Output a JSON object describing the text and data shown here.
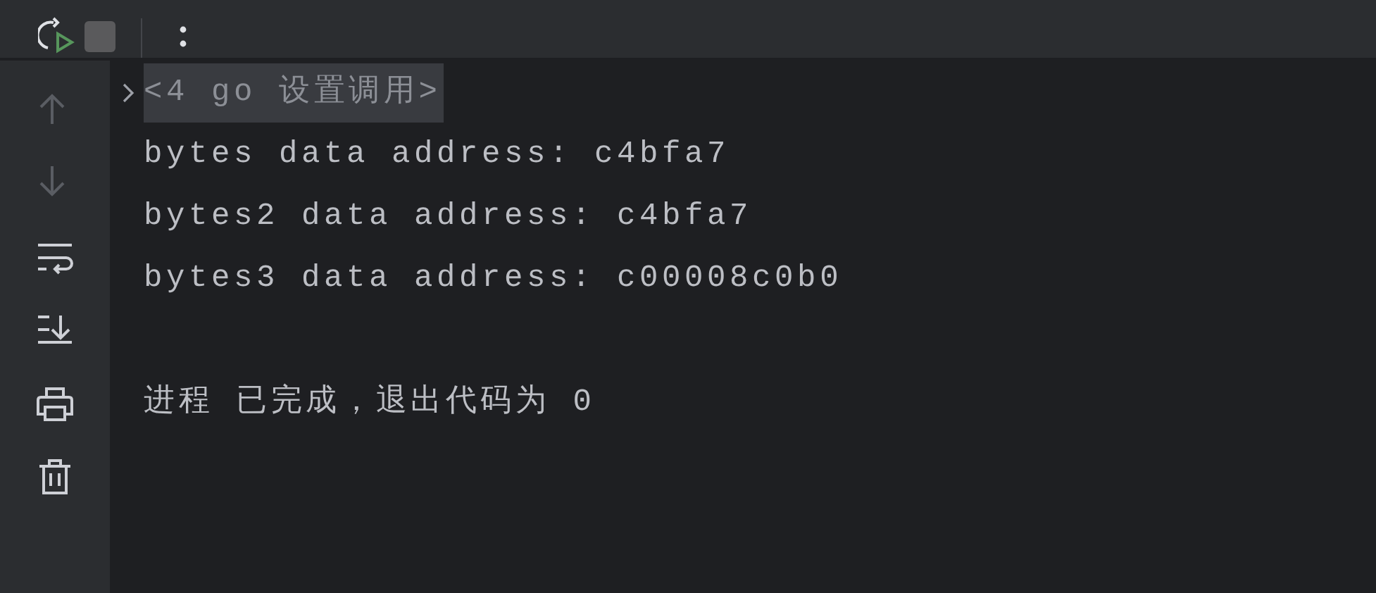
{
  "toolbar": [
    {
      "kind": "rerun",
      "disabled": false
    },
    {
      "kind": "stop",
      "disabled": true
    },
    {
      "kind": "more",
      "disabled": false
    }
  ],
  "sidebar": [
    {
      "kind": "up",
      "disabled": true
    },
    {
      "kind": "down",
      "disabled": true
    },
    {
      "kind": "wrap",
      "disabled": false
    },
    {
      "kind": "scroll-end",
      "disabled": false
    },
    {
      "kind": "print",
      "disabled": false
    },
    {
      "kind": "trash",
      "disabled": false
    }
  ],
  "output": [
    {
      "kind": "fold",
      "text": "<4 go 设置调用>",
      "expanded": false
    },
    {
      "kind": "line",
      "text": "bytes data address: c4bfa7"
    },
    {
      "kind": "line",
      "text": "bytes2 data address: c4bfa7"
    },
    {
      "kind": "line",
      "text": "bytes3 data address: c00008c0b0"
    },
    {
      "kind": "status",
      "text": "进程 已完成，退出代码为 0"
    }
  ]
}
